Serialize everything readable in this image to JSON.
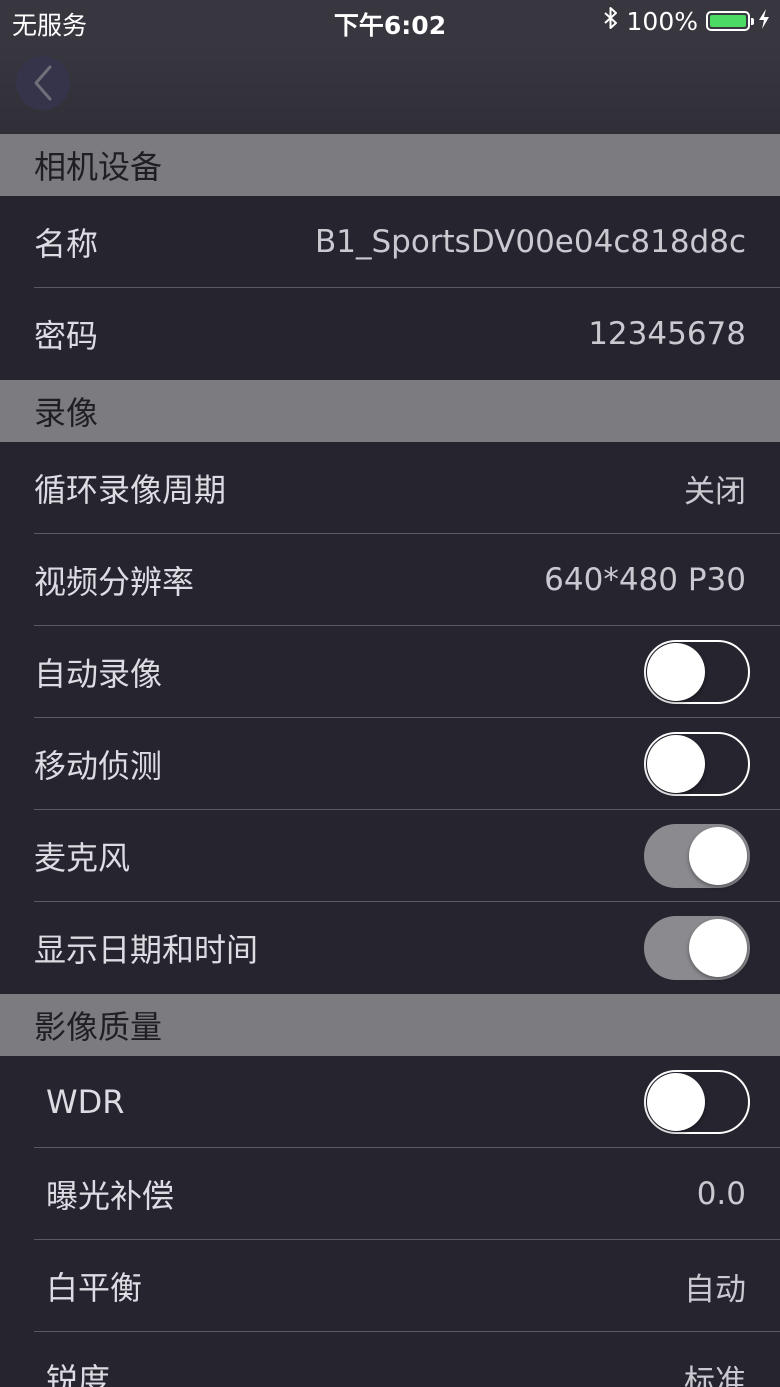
{
  "status_bar": {
    "carrier": "无服务",
    "time": "下午6:02",
    "battery_percent": "100%",
    "battery_level": 1.0,
    "battery_color": "#4cd964"
  },
  "nav": {
    "back_icon": "chevron-left-icon"
  },
  "sections": {
    "camera": {
      "header": "相机设备",
      "name_label": "名称",
      "name_value": "B1_SportsDV00e04c818d8c",
      "password_label": "密码",
      "password_value": "12345678"
    },
    "recording": {
      "header": "录像",
      "loop_label": "循环录像周期",
      "loop_value": "关闭",
      "resolution_label": "视频分辨率",
      "resolution_value": "640*480 P30",
      "auto_record_label": "自动录像",
      "auto_record_on": false,
      "motion_detect_label": "移动侦测",
      "motion_detect_on": false,
      "microphone_label": "麦克风",
      "microphone_on": true,
      "datetime_label": "显示日期和时间",
      "datetime_on": true
    },
    "image_quality": {
      "header": "影像质量",
      "wdr_label": "WDR",
      "wdr_on": false,
      "exposure_label": "曝光补偿",
      "exposure_value": "0.0",
      "white_balance_label": "白平衡",
      "white_balance_value": "自动",
      "sharpness_label": "锐度",
      "sharpness_value": "标准"
    }
  },
  "colors": {
    "background": "#25242f",
    "section_header": "#7b7b80",
    "toggle_on": "#8a8a8f",
    "separator": "#5a5a64"
  }
}
